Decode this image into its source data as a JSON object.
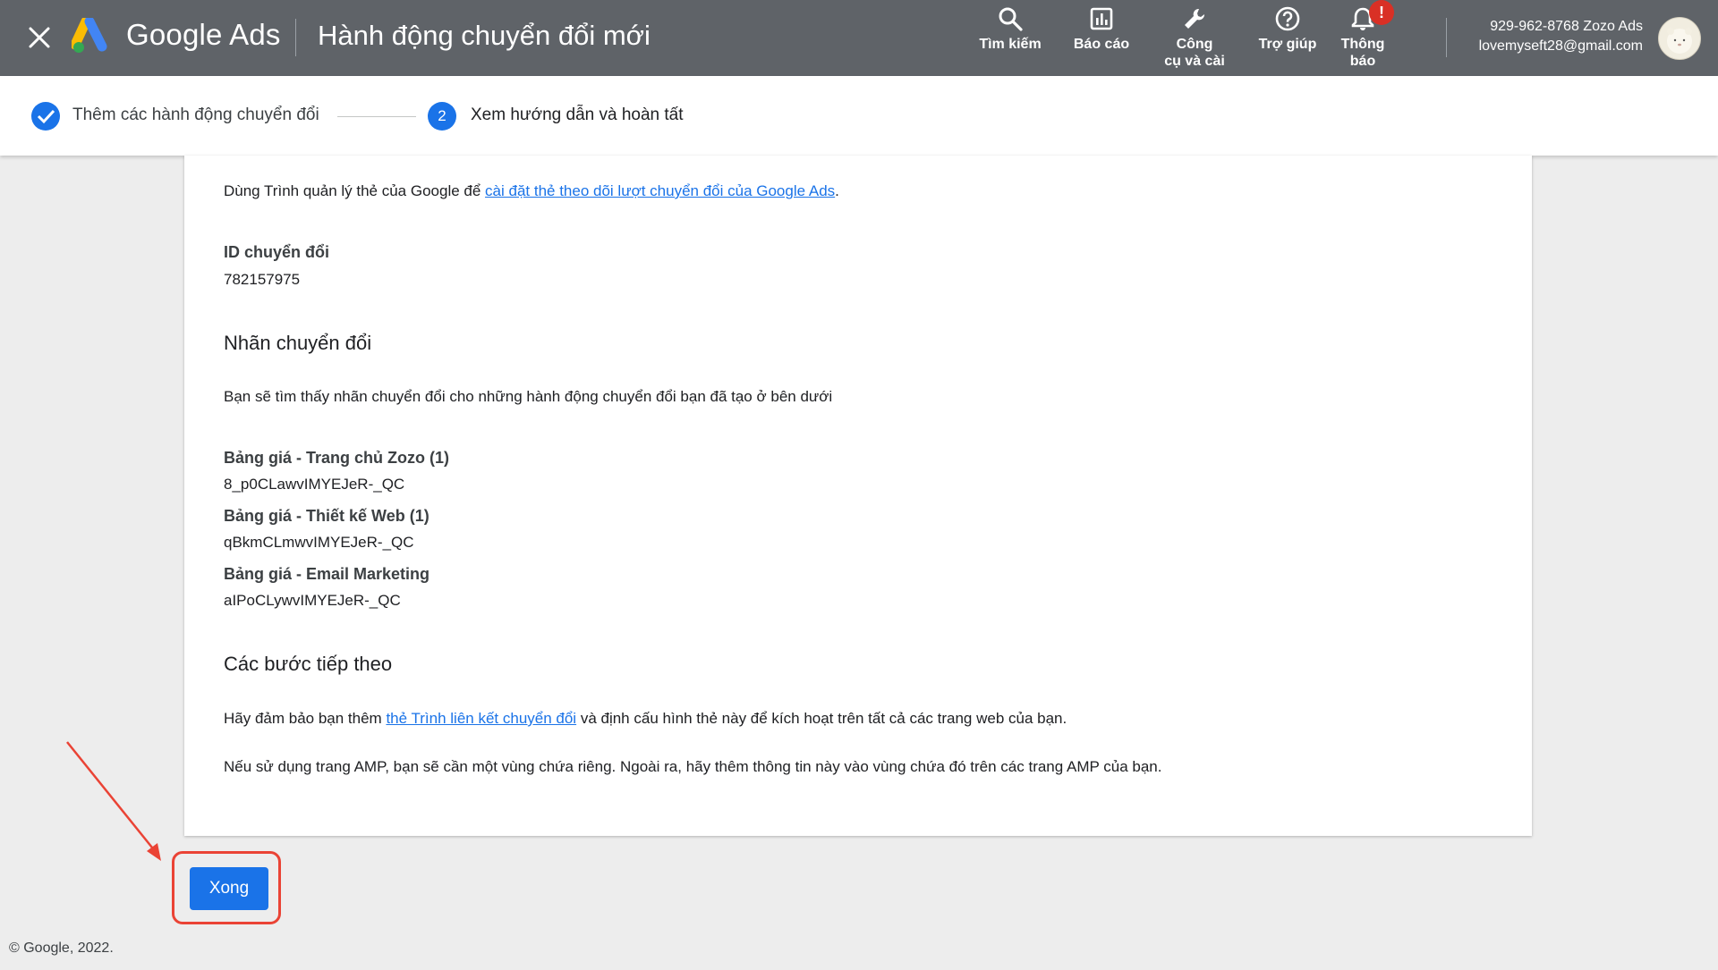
{
  "header": {
    "brand": "Google Ads",
    "page_title": "Hành động chuyển đổi mới",
    "tools": [
      {
        "icon": "search-icon",
        "label": "Tìm kiếm"
      },
      {
        "icon": "reports-icon",
        "label": "Báo cáo"
      },
      {
        "icon": "wrench-icon",
        "label_line1": "Công",
        "label_line2": "cụ và cài"
      },
      {
        "icon": "help-icon",
        "label": "Trợ giúp"
      },
      {
        "icon": "bell-icon",
        "label_line1": "Thông",
        "label_line2": "báo",
        "badge": "!"
      }
    ],
    "account": {
      "id_name": "929-962-8768 Zozo Ads",
      "email": "lovemyseft28@gmail.com"
    }
  },
  "stepper": {
    "step1_label": "Thêm các hành động chuyển đổi",
    "step2_number": "2",
    "step2_label": "Xem hướng dẫn và hoàn tất"
  },
  "content": {
    "intro_prefix": "Dùng Trình quản lý thẻ của Google để ",
    "intro_link": "cài đặt thẻ theo dõi lượt chuyển đổi của Google Ads",
    "intro_suffix": ".",
    "conversion_id_label": "ID chuyển đổi",
    "conversion_id_value": "782157975",
    "labels_heading": "Nhãn chuyển đổi",
    "labels_description": "Bạn sẽ tìm thấy nhãn chuyển đổi cho những hành động chuyển đổi bạn đã tạo ở bên dưới",
    "conversion_labels": [
      {
        "name": "Bảng giá - Trang chủ Zozo (1)",
        "value": "8_p0CLawvIMYEJeR-_QC"
      },
      {
        "name": "Bảng giá - Thiết kế Web (1)",
        "value": "qBkmCLmwvIMYEJeR-_QC"
      },
      {
        "name": "Bảng giá - Email Marketing",
        "value": "aIPoCLywvIMYEJeR-_QC"
      }
    ],
    "next_heading": "Các bước tiếp theo",
    "next_p1_prefix": "Hãy đảm bảo bạn thêm ",
    "next_p1_link": "thẻ Trình liên kết chuyển đổi",
    "next_p1_suffix": " và định cấu hình thẻ này để kích hoạt trên tất cả các trang web của bạn.",
    "next_p2": "Nếu sử dụng trang AMP, bạn sẽ cần một vùng chứa riêng. Ngoài ra, hãy thêm thông tin này vào vùng chứa đó trên các trang AMP của bạn."
  },
  "done_button_label": "Xong",
  "footer": "© Google, 2022.",
  "colors": {
    "topbar": "#5f6368",
    "accent": "#1a73e8",
    "annotation": "#ea4335",
    "badge": "#d93025"
  }
}
